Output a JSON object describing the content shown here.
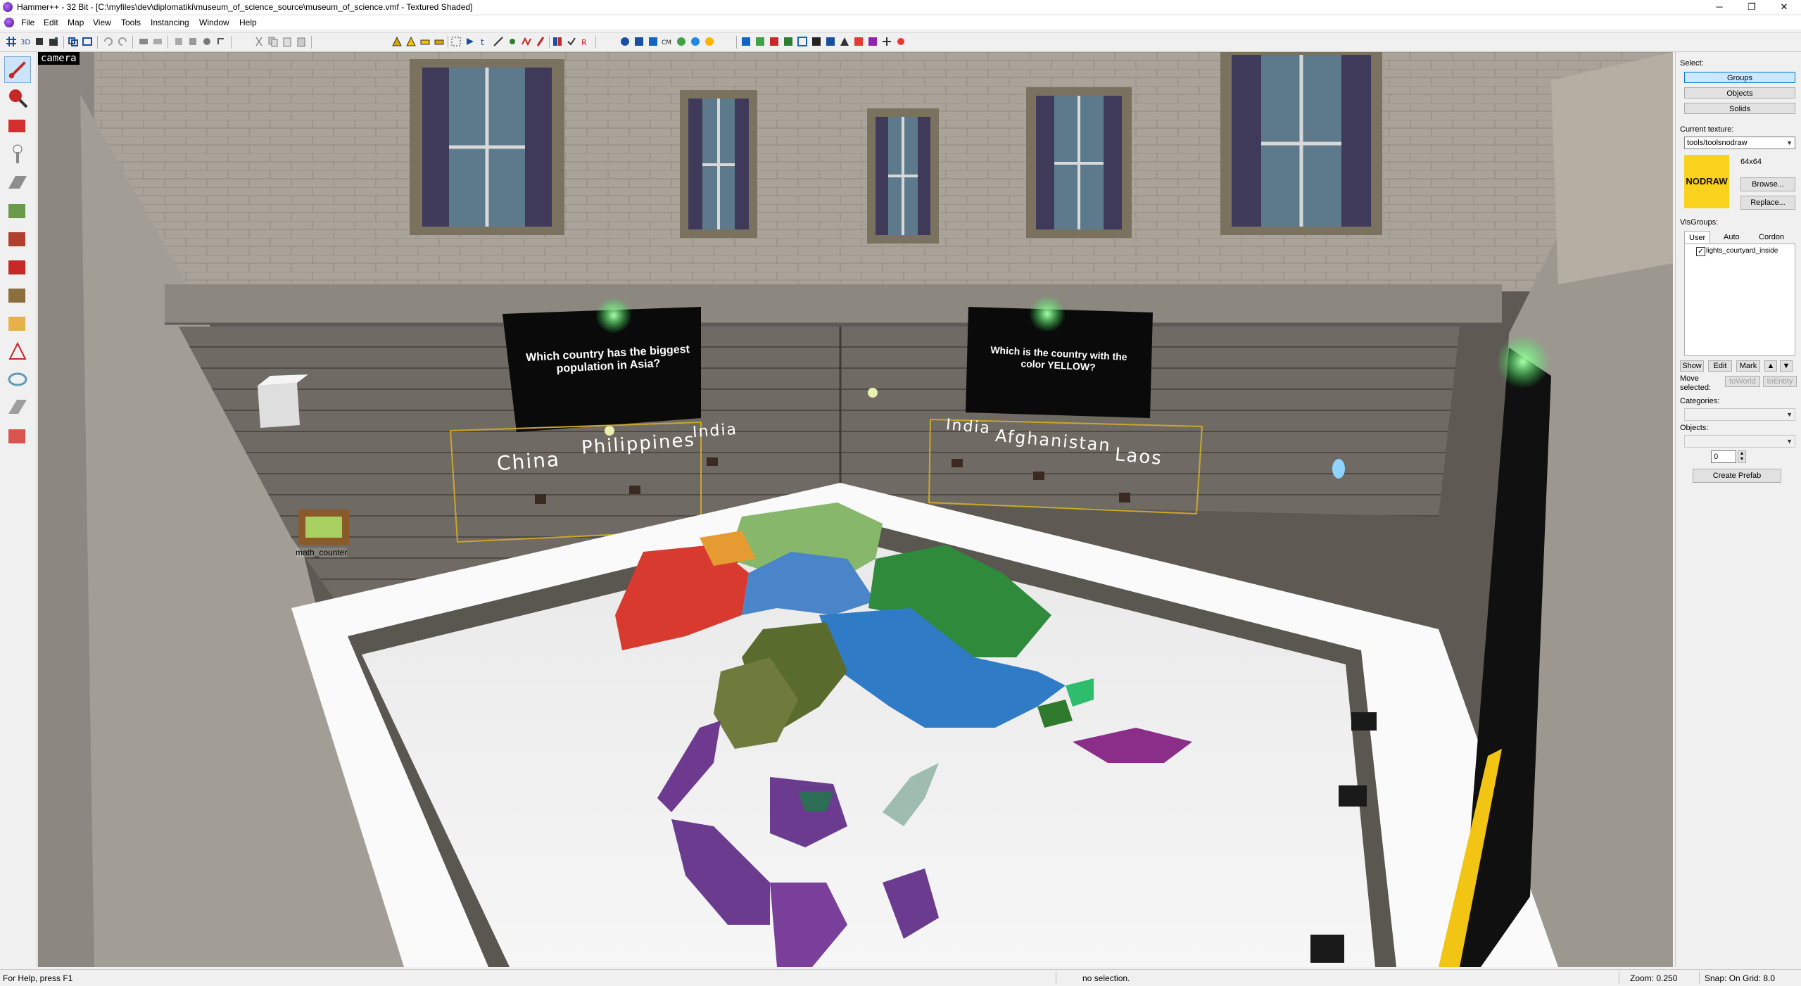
{
  "window": {
    "title": "Hammer++ - 32 Bit - [C:\\myfiles\\dev\\diplomatiki\\museum_of_science_source\\museum_of_science.vmf - Textured Shaded]",
    "minimize": "─",
    "restore": "❐",
    "close": "✕"
  },
  "menu": [
    "File",
    "Edit",
    "Map",
    "View",
    "Tools",
    "Instancing",
    "Window",
    "Help"
  ],
  "viewport": {
    "label": "camera",
    "screens": [
      {
        "question": "Which country has the biggest population in Asia?",
        "answers": [
          "China",
          "Philippines",
          "India"
        ]
      },
      {
        "question": "Which is the country with the color YELLOW?",
        "answers": [
          "India",
          "Afghanistan",
          "Laos"
        ]
      }
    ],
    "entity_label": "math_counter"
  },
  "right_panel": {
    "select_label": "Select:",
    "select_buttons": [
      "Groups",
      "Objects",
      "Solids"
    ],
    "current_texture_label": "Current texture:",
    "texture_value": "tools/toolsnodraw",
    "texture_preview": "NODRAW",
    "texture_size": "64x64",
    "browse_button": "Browse...",
    "replace_button": "Replace...",
    "visgroups_label": "VisGroups:",
    "vis_tabs": [
      "User",
      "Auto",
      "Cordon"
    ],
    "visgroup_item": "lights_courtyard_inside",
    "show_button": "Show",
    "edit_button": "Edit",
    "mark_button": "Mark",
    "move_selected_label": "Move selected:",
    "to_world_button": "toWorld",
    "to_entity_button": "toEntity",
    "categories_label": "Categories:",
    "objects_label": "Objects:",
    "objects_count": "0",
    "create_prefab_button": "Create Prefab"
  },
  "status": {
    "help": "For Help, press F1",
    "selection": "no selection.",
    "zoom": "Zoom: 0.250",
    "snap": "Snap: On Grid: 8.0"
  }
}
